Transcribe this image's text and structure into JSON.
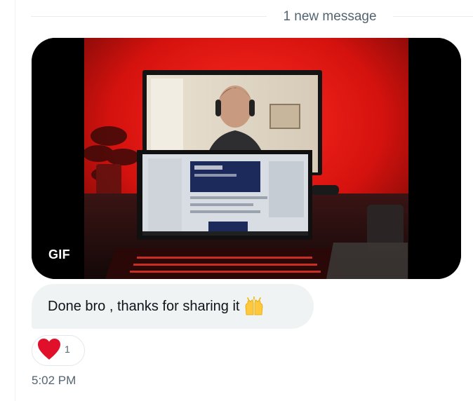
{
  "thread": {
    "divider_text": "1 new message"
  },
  "message": {
    "media": {
      "kind_badge": "GIF"
    },
    "text": "Done bro , thanks for sharing it",
    "text_emoji": "raised-hands",
    "reaction": {
      "emoji": "heart",
      "count": "1"
    },
    "timestamp": "5:02 PM"
  },
  "colors": {
    "bubble_bg": "#eff3f4",
    "muted_text": "#536471",
    "heart": "#f91880"
  }
}
